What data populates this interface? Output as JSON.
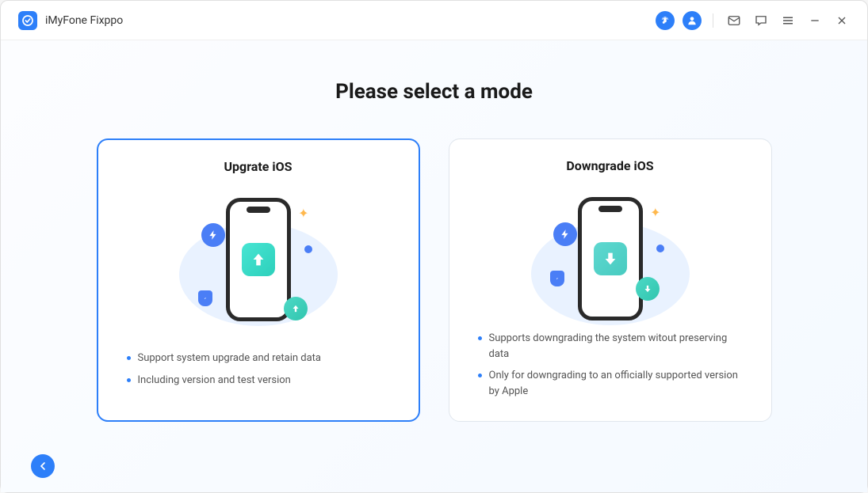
{
  "app": {
    "title": "iMyFone Fixppo"
  },
  "heading": "Please select a mode",
  "cards": {
    "upgrade": {
      "title": "Upgrate iOS",
      "feature1": "Support system upgrade and retain data",
      "feature2": "Including version and test version"
    },
    "downgrade": {
      "title": "Downgrade iOS",
      "feature1": "Supports downgrading the system witout preserving data",
      "feature2": "Only for downgrading to an officially supported version by Apple"
    }
  }
}
